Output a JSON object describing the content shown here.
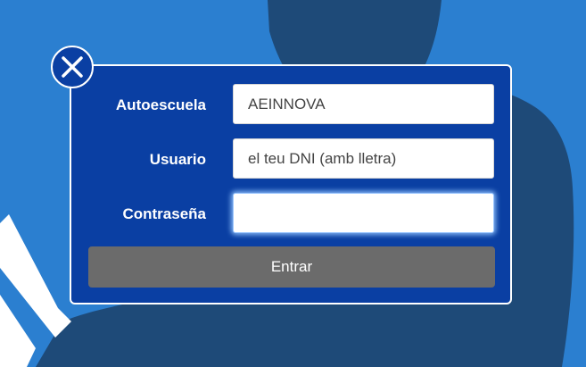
{
  "theme": {
    "background": "#2b7fd0",
    "silhouette": "#1e4a78",
    "panel": "#0a3fa3",
    "button": "#6b6b6b"
  },
  "close": {
    "icon": "close-icon"
  },
  "login": {
    "school_label": "Autoescuela",
    "school_value": "AEINNOVA",
    "user_label": "Usuario",
    "user_placeholder": "el teu DNI (amb lletra)",
    "password_label": "Contraseña",
    "password_value": "",
    "submit_label": "Entrar"
  }
}
